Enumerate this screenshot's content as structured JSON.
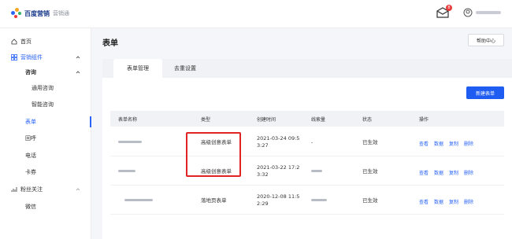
{
  "header": {
    "logo_text": "百度营销",
    "logo_sub": "营销通",
    "message_badge": "8",
    "logo_colors": [
      "#2a64f6",
      "#f5a623",
      "#34b366",
      "#e83a3a"
    ]
  },
  "sidebar": {
    "items": [
      {
        "label": "首页",
        "icon": "home-icon"
      },
      {
        "label": "营销组件",
        "icon": "grid-icon",
        "expanded": true
      },
      {
        "label": "咨询",
        "expanded": true
      },
      {
        "label": "通用咨询"
      },
      {
        "label": "智能咨询"
      },
      {
        "label": "表单",
        "active": true
      },
      {
        "label": "回呼"
      },
      {
        "label": "电话"
      },
      {
        "label": "卡券"
      },
      {
        "label": "粉丝关注",
        "icon": "fans-icon",
        "expanded": false
      },
      {
        "label": "微信"
      }
    ]
  },
  "main": {
    "title": "表单",
    "help_button": "帮助中心",
    "tabs": [
      {
        "label": "表单管理",
        "active": true
      },
      {
        "label": "去重设置",
        "active": false
      }
    ],
    "new_button": "新建表单",
    "table": {
      "headers": [
        "表单名称",
        "类型",
        "创建时间",
        "线索量",
        "状态",
        "操作"
      ],
      "rows": [
        {
          "type": "高级创意表单",
          "created_1": "2021-03-24 09:5",
          "created_2": "3:27",
          "leads": "-",
          "status": "已生效"
        },
        {
          "type": "高级创意表单",
          "created_1": "2021-03-22 17:2",
          "created_2": "3:32",
          "leads": "",
          "status": "已生效"
        },
        {
          "type": "落地页表单",
          "created_1": "2020-12-08 11:5",
          "created_2": "2:29",
          "leads": "",
          "status": "已生效"
        }
      ],
      "actions": [
        "查看",
        "数据",
        "复制",
        "删除"
      ]
    }
  },
  "colors": {
    "accent": "#2a64f6",
    "highlight": "#e02424",
    "status_active": "#2a64f6"
  }
}
